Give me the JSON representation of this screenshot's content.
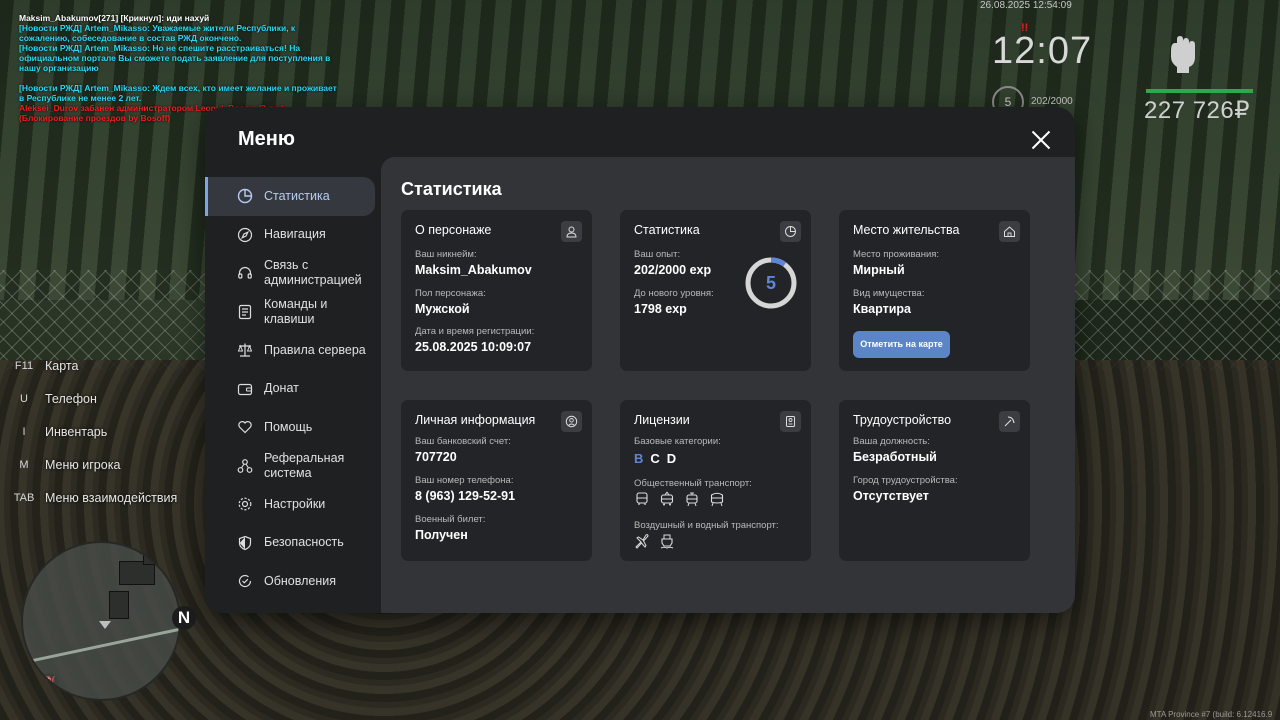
{
  "chat": [
    {
      "text": "Maksim_Abakumov[271] [Крикнул]: иди нахуй",
      "color": "white"
    },
    {
      "text": "[Новости РЖД] Artem_Mikasso: Уважаемые жители Республики, к сожалению, собеседование в состав РЖД окончено.",
      "color": "cyan"
    },
    {
      "text": "[Новости РЖД] Artem_Mikasso: Но не спешите расстраиваться! На официальном портале Вы сможете подать заявление для поступления в нашу организацию",
      "color": "cyan"
    },
    {
      "text": "[Новости РЖД] Artem_Mikasso: Ждем всех, кто имеет желание и проживает в Республике не менее 2 лет.",
      "color": "cyan"
    },
    {
      "text": "Aleksei_Durov забанен администратором Leonid_Bosow (3 дн.) (Блокирование проездов by Bosoff)",
      "color": "red"
    }
  ],
  "hud": {
    "date": "26.08.2025 12:54:09",
    "time": "12:07",
    "marker": "!!",
    "level": "5",
    "exp": "202/2000",
    "money": "227 726₽",
    "health_fraction": 1.0,
    "colors": {
      "health": "#2fa84a",
      "accent": "#5e86d8"
    }
  },
  "hotkeys": [
    {
      "key": "F11",
      "label": "Карта"
    },
    {
      "key": "U",
      "label": "Телефон"
    },
    {
      "key": "I",
      "label": "Инвентарь"
    },
    {
      "key": "M",
      "label": "Меню игрока"
    },
    {
      "key": "TAB",
      "label": "Меню взаимодействия"
    }
  ],
  "radar": {
    "north": "N",
    "fuel_icon": "fuel-icon"
  },
  "build": "MTA Province #7 (build: 6.12416.9",
  "menu": {
    "title": "Меню",
    "close_icon": "close-icon",
    "sidebar": [
      {
        "label": "Статистика",
        "icon": "chart-pie-icon",
        "active": true
      },
      {
        "label": "Навигация",
        "icon": "compass-icon"
      },
      {
        "label": "Связь с администрацией",
        "icon": "headset-icon"
      },
      {
        "label": "Команды и клавиши",
        "icon": "document-icon"
      },
      {
        "label": "Правила сервера",
        "icon": "scales-icon"
      },
      {
        "label": "Донат",
        "icon": "wallet-icon"
      },
      {
        "label": "Помощь",
        "icon": "heart-hand-icon"
      },
      {
        "label": "Реферальная система",
        "icon": "network-icon"
      },
      {
        "label": "Настройки",
        "icon": "gear-icon"
      },
      {
        "label": "Безопасность",
        "icon": "shield-icon"
      },
      {
        "label": "Обновления",
        "icon": "refresh-check-icon"
      }
    ],
    "content": {
      "title": "Статистика",
      "character": {
        "title": "О персонаже",
        "icon": "user-icon",
        "nickname_label": "Ваш никнейм:",
        "nickname": "Maksim_Abakumov",
        "gender_label": "Пол персонажа:",
        "gender": "Мужской",
        "reg_label": "Дата и время регистрации:",
        "reg": "25.08.2025 10:09:07"
      },
      "stats": {
        "title": "Статистика",
        "icon": "chart-pie-icon",
        "exp_label": "Ваш опыт:",
        "exp": "202/2000 exp",
        "next_label": "До нового уровня:",
        "next": "1798 exp",
        "level": "5",
        "progress_fraction": 0.101
      },
      "residence": {
        "title": "Место жительства",
        "icon": "home-icon",
        "place_label": "Место проживания:",
        "place": "Мирный",
        "property_label": "Вид имущества:",
        "property": "Квартира",
        "button": "Отметить на карте"
      },
      "personal": {
        "title": "Личная информация",
        "icon": "user-circle-icon",
        "bank_label": "Ваш банковский счет:",
        "bank": "707720",
        "phone_label": "Ваш номер телефона:",
        "phone": "8 (963) 129-52-91",
        "military_label": "Военный билет:",
        "military": "Получен"
      },
      "licenses": {
        "title": "Лицензии",
        "icon": "id-card-icon",
        "base_label": "Базовые категории:",
        "categories": [
          {
            "name": "B",
            "owned": true
          },
          {
            "name": "C",
            "owned": false
          },
          {
            "name": "D",
            "owned": false
          }
        ],
        "public_label": "Общественный транспорт:",
        "public_icons": [
          "bus-icon",
          "trolleybus-icon",
          "tram-icon",
          "metro-icon"
        ],
        "air_water_label": "Воздушный и водный транспорт:",
        "air_water_icons": [
          "airplane-icon",
          "ship-icon"
        ]
      },
      "employment": {
        "title": "Трудоустройство",
        "icon": "pickaxe-icon",
        "position_label": "Ваша должность:",
        "position": "Безработный",
        "city_label": "Город трудоустройства:",
        "city": "Отсутствует"
      }
    }
  }
}
